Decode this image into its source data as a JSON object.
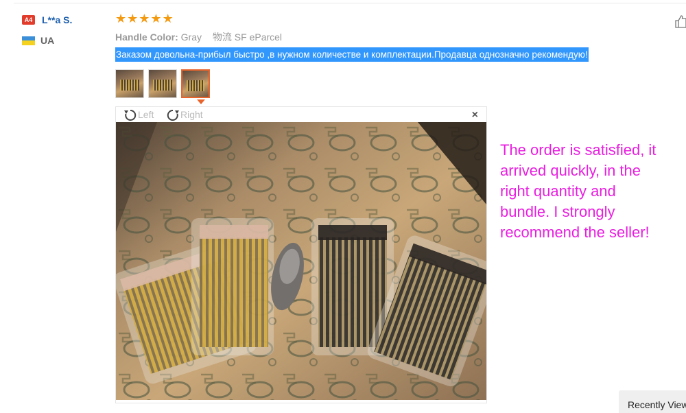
{
  "buyer": {
    "level": "A4",
    "name": "L**a S.",
    "country": "UA"
  },
  "review": {
    "rating": 5,
    "attr_label": "Handle Color:",
    "attr_value": "Gray",
    "shipping": "物流 SF eParcel",
    "text": "Заказом довольна-прибыл быстро ,в нужном количестве и комплектации.Продавца однозначно рекомендую!"
  },
  "viewer": {
    "rotate_left": "Left",
    "rotate_right": "Right",
    "close": "×"
  },
  "annotation": "The order is satisfied, it\n arrived quickly, in the\nright quantity and\nbundle. I strongly\nrecommend the seller!",
  "recently_viewed": "Recently Viewed",
  "colors": {
    "accent": "#e8642c",
    "highlight": "#3297fd",
    "annotation": "#e91ee0",
    "star": "#f39a11"
  }
}
